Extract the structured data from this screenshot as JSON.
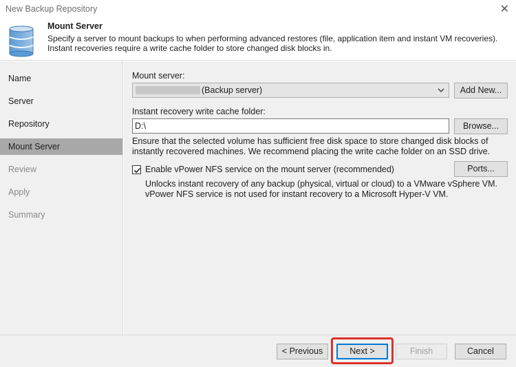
{
  "window": {
    "title": "New Backup Repository",
    "close_glyph": "✕"
  },
  "header": {
    "title": "Mount Server",
    "description": "Specify a server to mount backups to when performing advanced restores (file, application item and instant VM recoveries). Instant recoveries require a write cache folder to store changed disk blocks in.",
    "icon": "database-icon"
  },
  "steps": [
    {
      "label": "Name",
      "state": "done"
    },
    {
      "label": "Server",
      "state": "done"
    },
    {
      "label": "Repository",
      "state": "done"
    },
    {
      "label": "Mount Server",
      "state": "active"
    },
    {
      "label": "Review",
      "state": "disabled"
    },
    {
      "label": "Apply",
      "state": "disabled"
    },
    {
      "label": "Summary",
      "state": "disabled"
    }
  ],
  "mount_server": {
    "label": "Mount server:",
    "value": "(Backup server)",
    "add_new_label": "Add New..."
  },
  "cache_folder": {
    "label": "Instant recovery write cache folder:",
    "value": "D:\\",
    "browse_label": "Browse...",
    "note": "Ensure that the selected volume has sufficient free disk space to store changed disk blocks of instantly recovered machines. We recommend placing the write cache folder on an SSD drive."
  },
  "vpower": {
    "checked": true,
    "label": "Enable vPower NFS service on the mount server (recommended)",
    "ports_label": "Ports...",
    "description": "Unlocks instant recovery of any backup (physical, virtual or cloud) to a VMware vSphere VM. vPower NFS service is not used for instant recovery to a Microsoft Hyper-V VM."
  },
  "footer": {
    "previous_label": "< Previous",
    "next_label": "Next >",
    "finish_label": "Finish",
    "cancel_label": "Cancel",
    "highlight_color": "#d9322e"
  }
}
